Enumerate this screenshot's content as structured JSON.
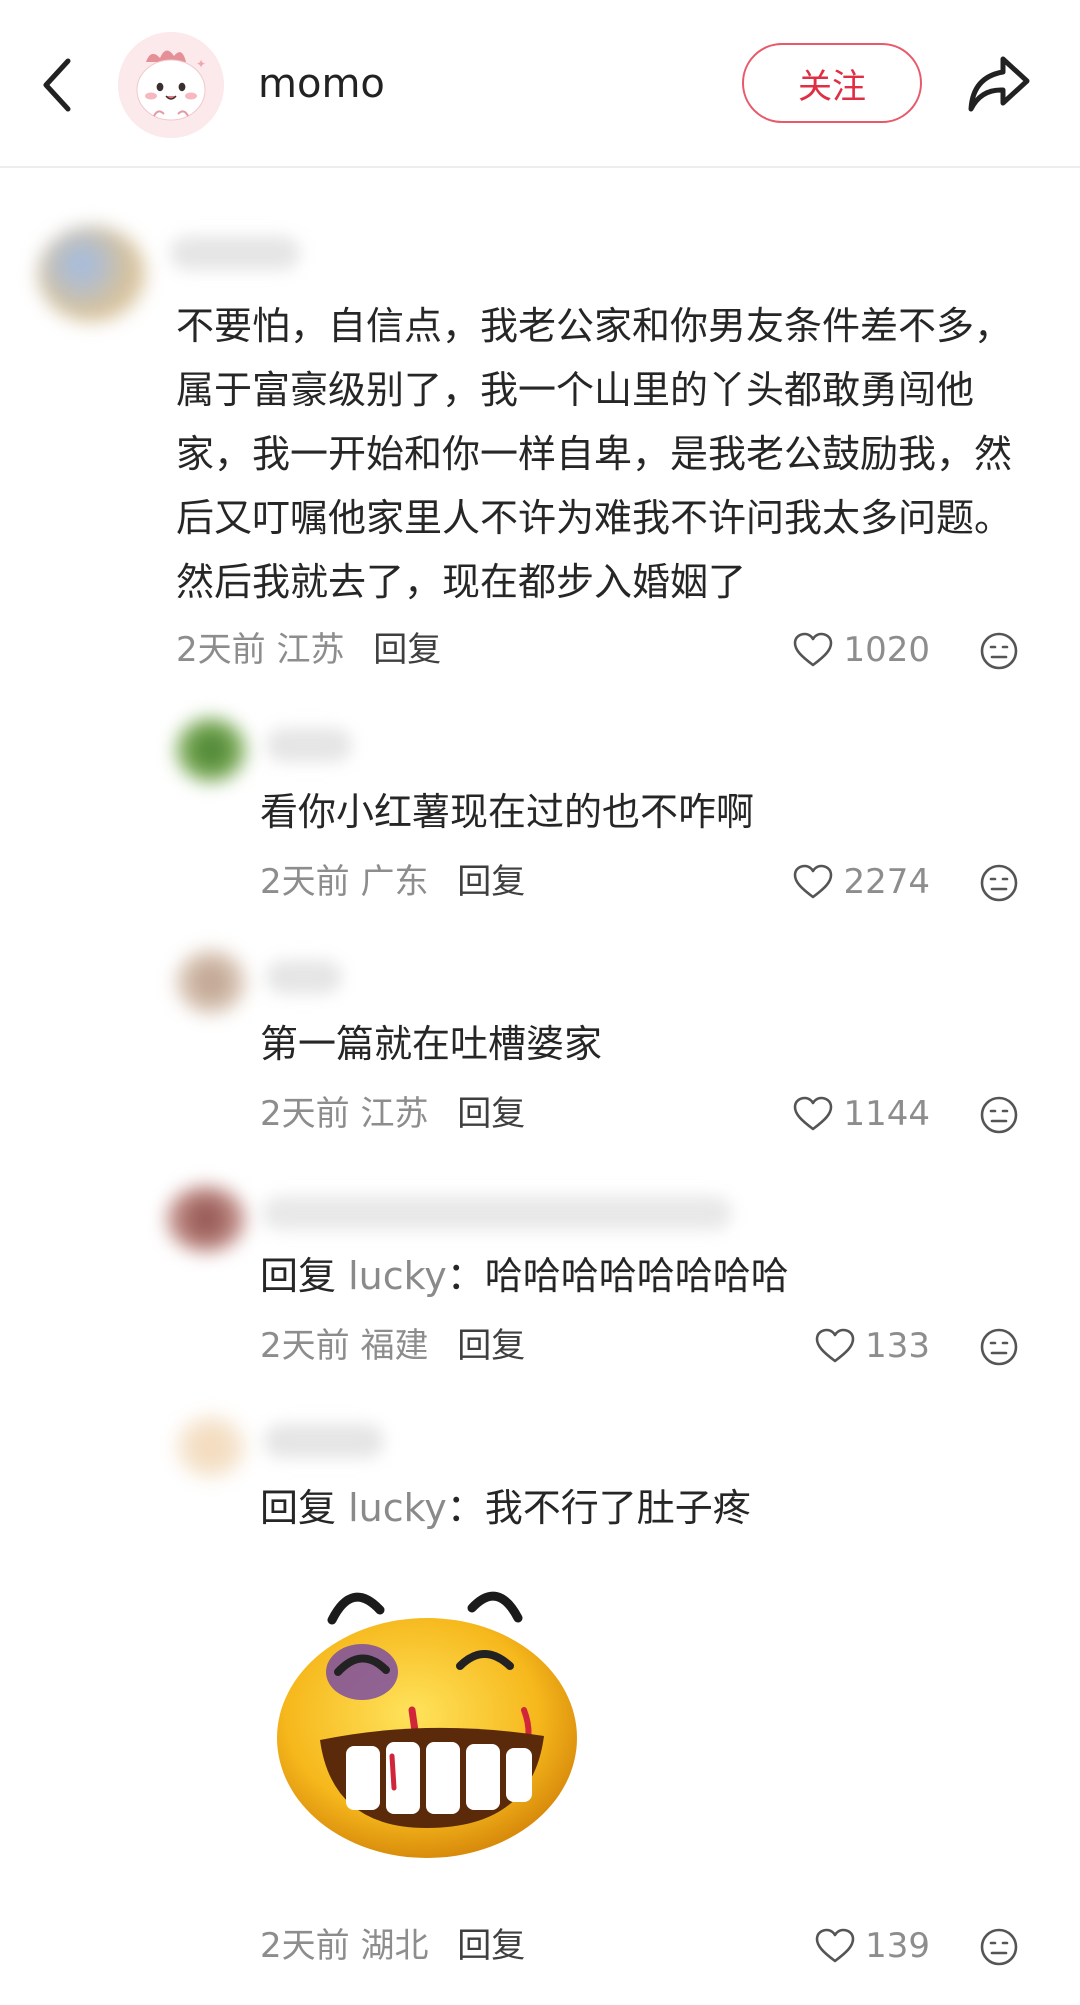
{
  "header": {
    "username": "momo",
    "follow_label": "关注",
    "icons": {
      "back": "back-arrow-icon",
      "share": "share-icon"
    }
  },
  "colors": {
    "follow_accent": "#e02e44",
    "secondary_text": "#8d8d8d"
  },
  "comments": [
    {
      "text": "不要怕，自信点，我老公家和你男友条件差不多，属于富豪级别了，我一个山里的丫头都敢勇闯他家，我一开始和你一样自卑，是我老公鼓励我，然后又叮嘱他家里人不许为难我不许问我太多问题。然后我就去了，现在都步入婚姻了",
      "time": "2天前",
      "location": "江苏",
      "reply_label": "回复",
      "likes": "1020"
    },
    {
      "text": "看你小红薯现在过的也不咋啊",
      "time": "2天前",
      "location": "广东",
      "reply_label": "回复",
      "likes": "2274"
    },
    {
      "text": "第一篇就在吐槽婆家",
      "time": "2天前",
      "location": "江苏",
      "reply_label": "回复",
      "likes": "1144"
    },
    {
      "reply_prefix": "回复",
      "reply_to": "lucky",
      "text": "：哈哈哈哈哈哈哈哈",
      "time": "2天前",
      "location": "福建",
      "reply_label": "回复",
      "likes": "133"
    },
    {
      "reply_prefix": "回复",
      "reply_to": "lucky",
      "text": "：我不行了肚子疼",
      "has_sticker": true,
      "sticker_icon": "laughing-bruised-face-sticker",
      "time": "2天前",
      "location": "湖北",
      "reply_label": "回复",
      "likes": "139"
    }
  ]
}
